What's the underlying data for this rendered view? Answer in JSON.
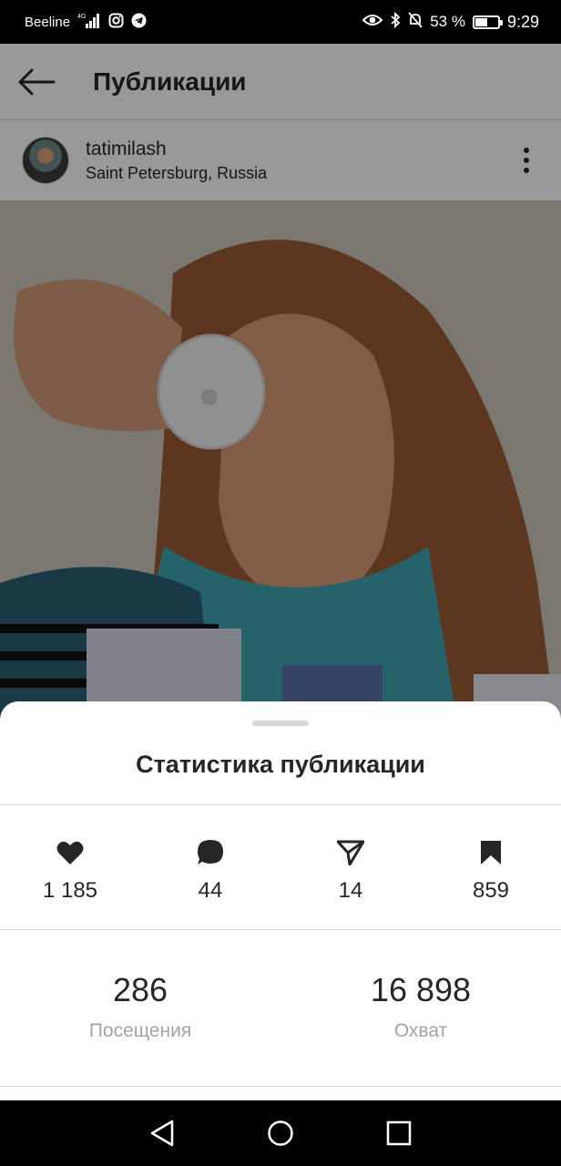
{
  "status_bar": {
    "carrier": "Beeline",
    "battery": "53 %",
    "battery_level": 0.53,
    "time": "9:29"
  },
  "header": {
    "title": "Публикации"
  },
  "post": {
    "username": "tatimilash",
    "location": "Saint Petersburg, Russia"
  },
  "sheet": {
    "title": "Статистика публикации",
    "metrics": [
      {
        "icon": "heart-icon",
        "value": "1 185"
      },
      {
        "icon": "comment-icon",
        "value": "44"
      },
      {
        "icon": "share-icon",
        "value": "14"
      },
      {
        "icon": "bookmark-icon",
        "value": "859"
      }
    ],
    "summary": [
      {
        "value": "286",
        "label": "Посещения"
      },
      {
        "value": "16 898",
        "label": "Охват"
      }
    ]
  },
  "colors": {
    "text_primary": "#262626",
    "text_secondary": "#a3a3a3",
    "divider": "#dbdbdb"
  }
}
